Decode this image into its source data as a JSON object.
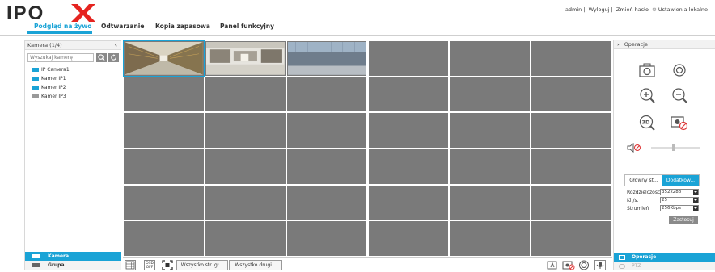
{
  "app": {
    "logo_text": "IPOX",
    "accent_color": "#1aa3d6"
  },
  "header": {
    "user": "admin",
    "sep1": "|",
    "logout": "Wyloguj",
    "sep2": "|",
    "change_password": "Zmień hasło",
    "local_settings": "Ustawienia lokalne"
  },
  "nav": {
    "tabs": [
      {
        "label": "Podgląd na żywo",
        "active": true
      },
      {
        "label": "Odtwarzanie",
        "active": false
      },
      {
        "label": "Kopia zapasowa",
        "active": false
      },
      {
        "label": "Panel funkcyjny",
        "active": false
      }
    ]
  },
  "left_panel": {
    "title": "Kamera (1/4)",
    "collapse_icon": "‹",
    "search_placeholder": "Wyszukaj kamerę",
    "cameras": [
      {
        "name": "IP Camera1",
        "online": true
      },
      {
        "name": "Kamer IP1",
        "online": true
      },
      {
        "name": "Kamer IP2",
        "online": true
      },
      {
        "name": "Kamer IP3",
        "online": false
      }
    ],
    "footer_camera": "Kamera",
    "footer_group": "Grupa"
  },
  "grid": {
    "columns": 6,
    "rows": 6,
    "selected_index": 0,
    "feeds": [
      "warehouse",
      "warehouse-2",
      "atrium"
    ]
  },
  "toolbar": {
    "osd_label": "OSD OFF",
    "main_stream_button": "Wszystko str. gł...",
    "sub_stream_button": "Wszystko drugi..."
  },
  "right_panel": {
    "title": "Operacje",
    "expand_icon": "›",
    "stream_tabs": [
      {
        "label": "Główny st...",
        "active": false
      },
      {
        "label": "Dodatkow...",
        "active": true
      }
    ],
    "fields": [
      {
        "label": "Rozdzielczość",
        "value": "352x288"
      },
      {
        "label": "Kl./s.",
        "value": "25"
      },
      {
        "label": "Strumień",
        "value": "256Kbps"
      }
    ],
    "apply_button": "Zastosuj",
    "footer_operations": "Operacje",
    "footer_ptz": "PTZ"
  }
}
